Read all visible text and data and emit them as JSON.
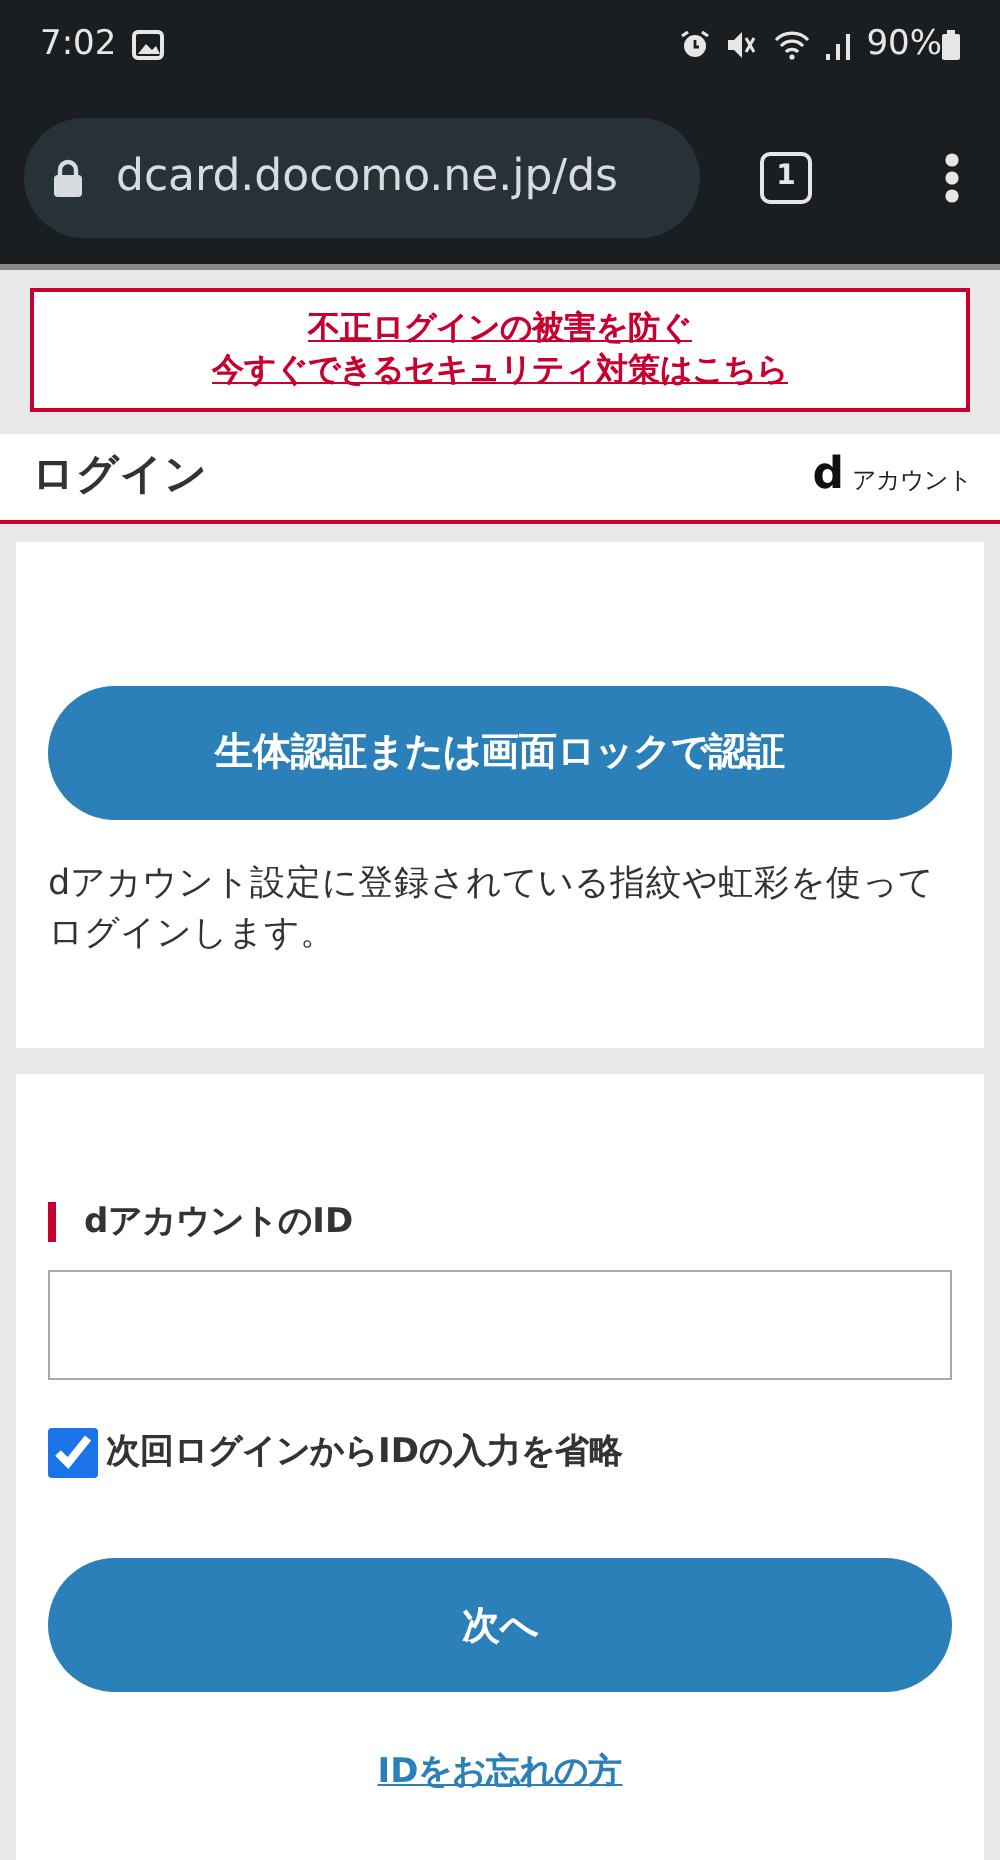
{
  "status_bar": {
    "time": "7:02",
    "battery": "90%"
  },
  "browser": {
    "url": "dcard.docomo.ne.jp/ds",
    "tab_count": "1"
  },
  "banner": {
    "lines": [
      "不正ログインの被害を防ぐ",
      "今すぐできるセキュリティ対策はこちら"
    ]
  },
  "header": {
    "title": "ログイン",
    "brand_mark": "d",
    "brand_text": "アカウント"
  },
  "biometric": {
    "button": "生体認証または画面ロックで認証",
    "description": "dアカウント設定に登録されている指紋や虹彩を使ってログインします。"
  },
  "login": {
    "label": "dアカウントのID",
    "remember": {
      "label": "次回ログインからIDの入力を省略",
      "checked": true
    },
    "next_button": "次へ",
    "forgot_link": "IDをお忘れの方"
  }
}
